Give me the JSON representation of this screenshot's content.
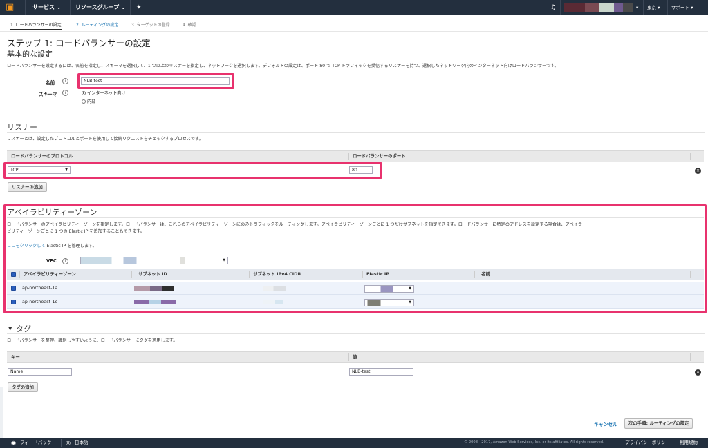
{
  "topnav": {
    "services": "サービス",
    "resource_groups": "リソースグループ",
    "region": "東京",
    "support": "サポート"
  },
  "wizard": {
    "steps": [
      {
        "label": "1. ロードバランサーの設定"
      },
      {
        "label": "2. ルーティングの設定"
      },
      {
        "label": "3. ターゲットの登録"
      },
      {
        "label": "4. 確認"
      }
    ]
  },
  "page": {
    "title": "ステップ 1: ロードバランサーの設定"
  },
  "basic": {
    "heading": "基本的な設定",
    "description": "ロードバランサーを設定するには、名前を指定し、スキーマを選択して、1 つ以上のリスナーを指定し、ネットワークを選択します。デフォルトの設定は、ポート 80 で TCP トラフィックを受信するリスナーを持つ、選択したネットワーク内のインターネット向けロードバランサーです。",
    "name_label": "名前",
    "name_value": "NLB-test",
    "scheme_label": "スキーマ",
    "scheme_options": [
      "インターネット向け",
      "内部"
    ]
  },
  "listeners": {
    "heading": "リスナー",
    "description": "リスナーとは、設定したプロトコルとポートを使用して接続リクエストをチェックするプロセスです。",
    "col_protocol": "ロードバランサーのプロトコル",
    "col_port": "ロードバランサーのポート",
    "protocol_value": "TCP",
    "port_value": "80",
    "add_button": "リスナーの追加"
  },
  "az": {
    "heading": "アベイラビリティーゾーン",
    "description_line1": "ロードバランサーのアベイラビリティーゾーンを指定します。ロードバランサーは、これらのアベイラビリティーゾーンにのみトラフィックをルーティングします。アベイラビリティーゾーンごとに 1 つだけサブネットを指定できます。ロードバランサーに特定のアドレスを設定する場合は、アベイラ",
    "description_line2": "ビリティーゾーンごとに 1 つの Elastic IP を追加することもできます。",
    "link_text": "ここをクリックして",
    "link_suffix": " Elastic IP を管理します。",
    "vpc_label": "VPC",
    "columns": [
      "アベイラビリティーゾーン",
      "サブネット ID",
      "サブネット IPv4 CIDR",
      "Elastic IP",
      "名前"
    ],
    "rows": [
      {
        "zone": "ap-northeast-1a"
      },
      {
        "zone": "ap-northeast-1c"
      }
    ]
  },
  "tags": {
    "heading": "タグ",
    "description": "ロードバランサーを整理、識別しやすいように、ロードバランサーにタグを適用します。",
    "col_key": "キー",
    "col_value": "値",
    "key_value": "Name",
    "value_value": "NLB-test",
    "add_button": "タグの追加"
  },
  "actions": {
    "cancel": "キャンセル",
    "next": "次の手順: ルーティングの設定"
  },
  "footer": {
    "feedback": "フィードバック",
    "language": "日本語",
    "copyright": "© 2008 - 2017, Amazon Web Services, Inc. or its affiliates. All rights reserved.",
    "privacy": "プライバシーポリシー",
    "terms": "利用規約"
  },
  "colors": {
    "nav_bg": "#232f3e",
    "highlight": "#e8326e",
    "link": "#1f77b4",
    "checkbox": "#2b5fbd"
  }
}
